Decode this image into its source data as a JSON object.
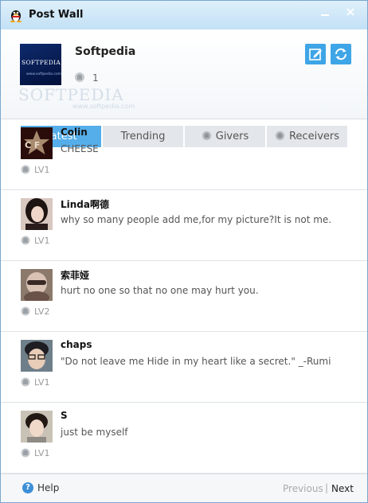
{
  "window": {
    "title": "Post Wall",
    "colors": {
      "accent": "#3ea5e6",
      "tab_active": "#55aee9",
      "tab_inactive": "#e3e6ea"
    }
  },
  "profile": {
    "name": "Softpedia",
    "count": "1",
    "avatar_text": "SOFTPEDIA",
    "avatar_subtext": "www.softpedia.com",
    "watermark": "SOFTPEDIA",
    "watermark_sub": "www.softpedia.com"
  },
  "actions": {
    "edit_icon": "edit-icon",
    "refresh_icon": "refresh-icon"
  },
  "tabs": [
    {
      "label": "Latest",
      "active": true,
      "icon": ""
    },
    {
      "label": "Trending",
      "active": false,
      "icon": ""
    },
    {
      "label": "Givers",
      "active": false,
      "icon": "gift-icon"
    },
    {
      "label": "Receivers",
      "active": false,
      "icon": "gift-icon"
    }
  ],
  "posts": [
    {
      "name": "Colin",
      "text": "CHEESE",
      "level": "LV1"
    },
    {
      "name": "Linda啊德",
      "text": "why so many people add me,for my picture?It is not me.",
      "level": "LV1"
    },
    {
      "name": "索菲娅",
      "text": "hurt no one so that no one may hurt you.",
      "level": "LV2"
    },
    {
      "name": "chaps",
      "text": "\"Do not leave me Hide in my heart like a secret.\" _-Rumi",
      "level": "LV1"
    },
    {
      "name": "S",
      "text": "just be myself",
      "level": "LV1"
    }
  ],
  "footer": {
    "help_label": "Help",
    "previous_label": "Previous",
    "separator": "|",
    "next_label": "Next"
  }
}
